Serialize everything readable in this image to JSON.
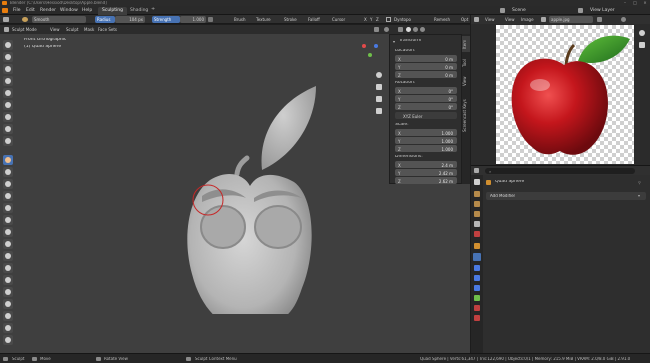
{
  "window": {
    "title": "Blender [C:\\Users\\Hessiod\\Desktop\\Apple.blend]"
  },
  "menu": {
    "items": [
      "File",
      "Edit",
      "Render",
      "Window",
      "Help"
    ],
    "workspaces": [
      {
        "label": "Sculpting",
        "active": true
      },
      {
        "label": "Shading",
        "active": false
      }
    ],
    "scene_label": "Scene",
    "view_layer_label": "View Layer"
  },
  "tool_settings": {
    "brush_name": "Smooth",
    "radius_label": "Radius",
    "radius_value": "104 px",
    "strength_label": "Strength",
    "strength_value": "1.000",
    "brush_menu": "Brush",
    "texture_menu": "Texture",
    "stroke_menu": "Stroke",
    "falloff_menu": "Falloff",
    "cursor_menu": "Cursor",
    "xyz_axes": [
      "X",
      "Y",
      "Z"
    ],
    "dyntopo_label": "Dyntopo",
    "remesh_label": "Remesh",
    "options_label": "Opt"
  },
  "viewport_header": {
    "mode": "Sculpt Mode",
    "menus": [
      "View",
      "Sculpt",
      "Mask",
      "Face Sets"
    ]
  },
  "viewport": {
    "view_name": "Front Orthographic",
    "object_name": "(1) Quad Sphere"
  },
  "n_panel": {
    "title": "Transform",
    "location_label": "Location:",
    "location": [
      {
        "axis": "X",
        "value": "0 m"
      },
      {
        "axis": "Y",
        "value": "0 m"
      },
      {
        "axis": "Z",
        "value": "0 m"
      }
    ],
    "rotation_label": "Rotation:",
    "rotation": [
      {
        "axis": "X",
        "value": "0°"
      },
      {
        "axis": "Y",
        "value": "0°"
      },
      {
        "axis": "Z",
        "value": "0°"
      }
    ],
    "rotation_mode": "XYZ Euler",
    "scale_label": "Scale:",
    "scale": [
      {
        "axis": "X",
        "value": "1.000"
      },
      {
        "axis": "Y",
        "value": "1.000"
      },
      {
        "axis": "Z",
        "value": "1.000"
      }
    ],
    "dimensions_label": "Dimensions:",
    "dimensions": [
      {
        "axis": "X",
        "value": "2.4 m"
      },
      {
        "axis": "Y",
        "value": "2.42 m"
      },
      {
        "axis": "Z",
        "value": "2.62 m"
      }
    ],
    "side_tabs": [
      "Item",
      "Tool",
      "View",
      "Screencast Keys"
    ]
  },
  "image_editor": {
    "menus": [
      "View",
      "View",
      "Image"
    ],
    "image_name": "apple.jpg"
  },
  "properties": {
    "object_name": "Quad Sphere",
    "add_modifier_label": "Add Modifier"
  },
  "status_bar": {
    "left_items": [
      "Sculpt",
      "Move",
      "Rotate View"
    ],
    "context_menu": "Sculpt Context Menu",
    "stats": "Quad Sphere | Verts:61,347 | Tris:122,690 | Objects:0/1 | Memory: 215.9 MiB | VRAM: 2.0/8.0 GiB | 2.91.0"
  },
  "colors": {
    "accent": "#4772b3",
    "viewport_bg": "#3f3f3f",
    "panel_bg": "#2e2e2e",
    "apple_red": "#b3121a",
    "leaf_green": "#2e8b2a",
    "annotation_red": "#c62828"
  }
}
